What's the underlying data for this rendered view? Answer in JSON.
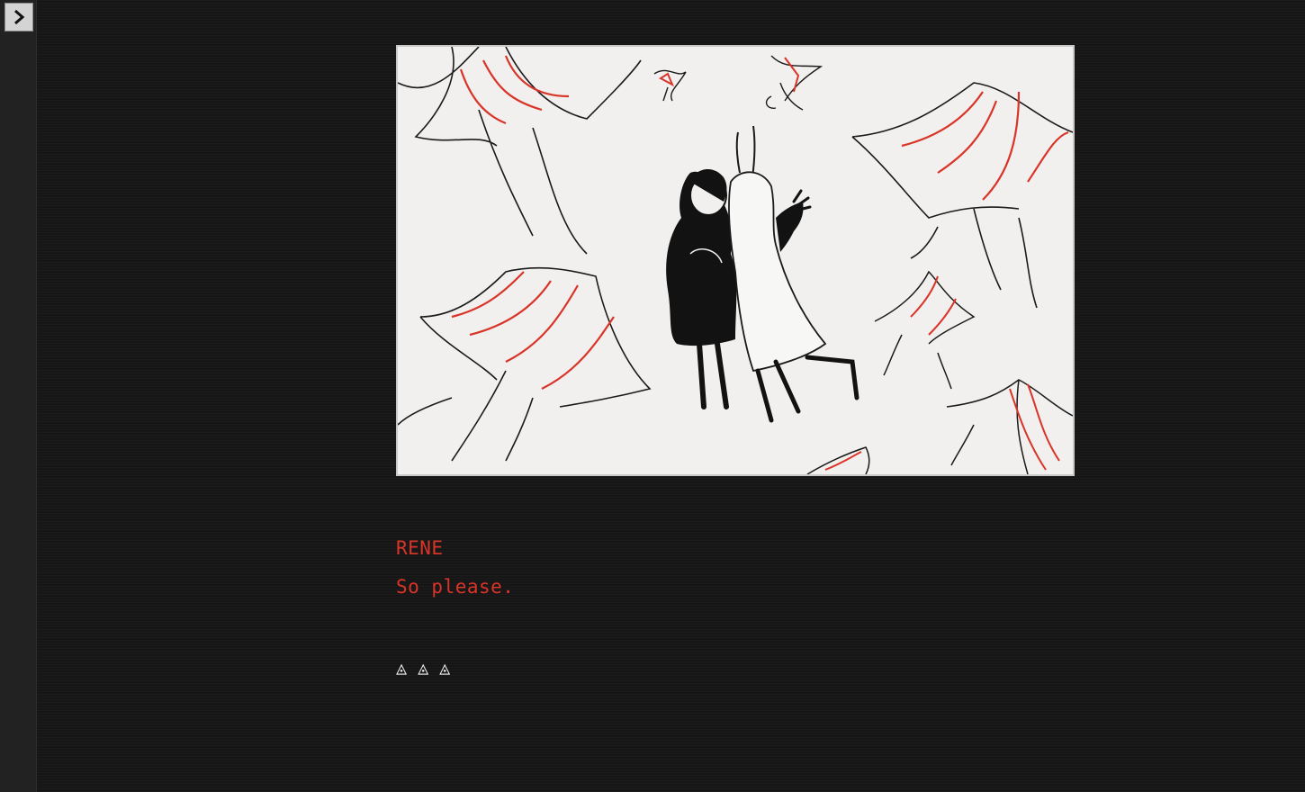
{
  "sidebar": {
    "toggle_icon": "chevron-right-icon"
  },
  "scene": {
    "accent_color": "#d93428",
    "ink_color": "#111111",
    "paper_color": "#f1f0ee"
  },
  "dialogue": {
    "speaker": "RENE",
    "text": "So please."
  },
  "continue": {
    "glyphs": "◬ ◬ ◬"
  }
}
